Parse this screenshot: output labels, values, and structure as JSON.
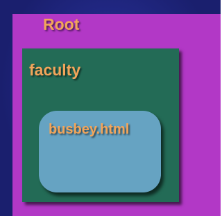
{
  "colors": {
    "background": "#1a1f6e",
    "root_fill": "#b238c6",
    "faculty_fill": "#236b56",
    "file_fill": "#66a3c2",
    "label_text": "#f2a55a"
  },
  "diagram": {
    "root": {
      "label": "Root"
    },
    "faculty": {
      "label": "faculty"
    },
    "file": {
      "label": "busbey.html"
    }
  }
}
